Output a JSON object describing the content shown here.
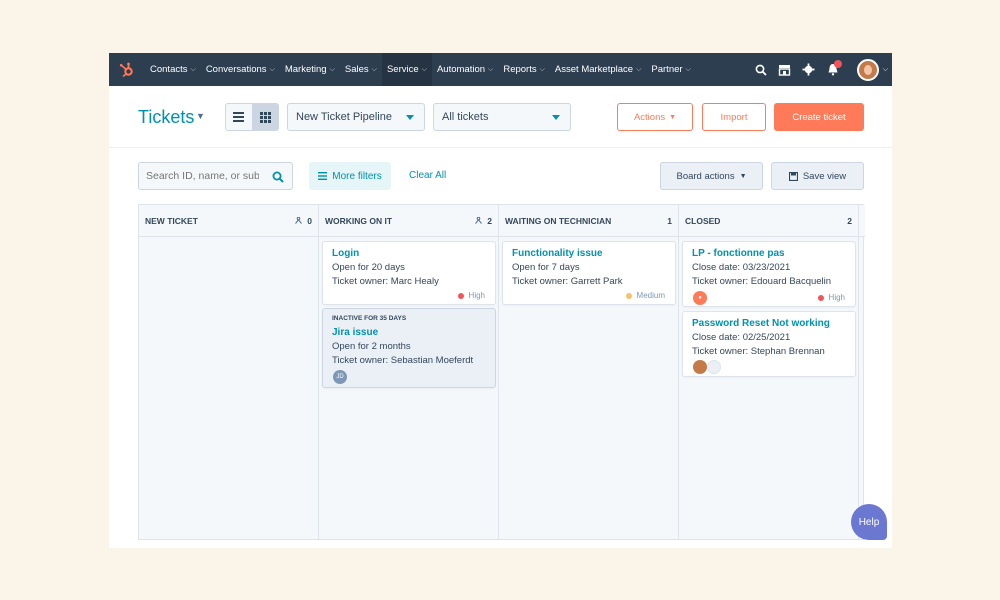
{
  "nav": {
    "items": [
      {
        "label": "Contacts"
      },
      {
        "label": "Conversations"
      },
      {
        "label": "Marketing"
      },
      {
        "label": "Sales"
      },
      {
        "label": "Service"
      },
      {
        "label": "Automation"
      },
      {
        "label": "Reports"
      },
      {
        "label": "Asset Marketplace"
      },
      {
        "label": "Partner"
      }
    ],
    "active": "Service",
    "notification_count": "1"
  },
  "header": {
    "title": "Tickets",
    "pipeline_select": "New Ticket Pipeline",
    "view_select": "All tickets",
    "actions_label": "Actions",
    "import_label": "Import",
    "create_label": "Create ticket"
  },
  "filters": {
    "search_placeholder": "Search ID, name, or subject",
    "more_filters_label": "More filters",
    "clear_all_label": "Clear All",
    "board_actions_label": "Board actions",
    "save_view_label": "Save view"
  },
  "board": {
    "columns": [
      {
        "title": "NEW TICKET",
        "count": "0",
        "cards": []
      },
      {
        "title": "WORKING ON IT",
        "count": "2",
        "cards": [
          {
            "tag": "",
            "title": "Login",
            "line1": "Open for 20 days",
            "line2": "Ticket owner: Marc Healy",
            "priority": "High",
            "priority_color": "#f2545b"
          },
          {
            "tag": "INACTIVE FOR 35 DAYS",
            "title": "Jira issue",
            "line1": "Open for 2 months",
            "line2": "Ticket owner: Sebastian Moeferdt",
            "avatar": "JD"
          }
        ]
      },
      {
        "title": "WAITING ON TECHNICIAN",
        "count": "1",
        "cards": [
          {
            "tag": "",
            "title": "Functionality issue",
            "line1": "Open for 7 days",
            "line2": "Ticket owner: Garrett Park",
            "priority": "Medium",
            "priority_color": "#f5c26b"
          }
        ]
      },
      {
        "title": "CLOSED",
        "count": "2",
        "cards": [
          {
            "tag": "",
            "title": "LP - fonctionne pas",
            "line1": "Close date: 03/23/2021",
            "line2": "Ticket owner: Edouard Bacquelin",
            "priority": "High",
            "priority_color": "#f2545b"
          },
          {
            "tag": "",
            "title": "Password Reset Not working",
            "line1": "Close date: 02/25/2021",
            "line2": "Ticket owner: Stephan Brennan"
          }
        ]
      }
    ]
  },
  "help_label": "Help",
  "colors": {
    "nav": "#2d3e50",
    "accent": "#ff7a59",
    "link": "#0091ae",
    "help": "#6a78d1"
  }
}
